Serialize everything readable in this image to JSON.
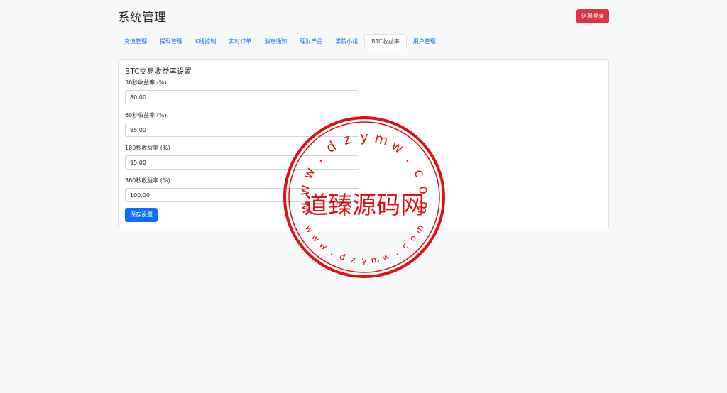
{
  "header": {
    "title": "系统管理",
    "logout_label": "退出登录"
  },
  "tabs": [
    {
      "label": "充值管理",
      "active": false
    },
    {
      "label": "提现管理",
      "active": false
    },
    {
      "label": "K线控制",
      "active": false
    },
    {
      "label": "实时订单",
      "active": false
    },
    {
      "label": "消息通知",
      "active": false
    },
    {
      "label": "理财产品",
      "active": false
    },
    {
      "label": "学院小组",
      "active": false
    },
    {
      "label": "BTC收益率",
      "active": true
    },
    {
      "label": "用户管理",
      "active": false
    }
  ],
  "form": {
    "title": "BTC交易收益率设置",
    "fields": [
      {
        "label": "30秒收益率 (%)",
        "value": "80.00"
      },
      {
        "label": "60秒收益率 (%)",
        "value": "85.00"
      },
      {
        "label": "180秒收益率 (%)",
        "value": "95.00"
      },
      {
        "label": "360秒收益率 (%)",
        "value": "100.00"
      }
    ],
    "save_label": "保存设置"
  },
  "watermark": {
    "center_text": "道臻源码网",
    "ring_text": "www.dzymw.com",
    "color": "#e01010"
  },
  "colors": {
    "primary": "#0d6efd",
    "danger": "#dc3545",
    "background": "#f8f9fa"
  }
}
